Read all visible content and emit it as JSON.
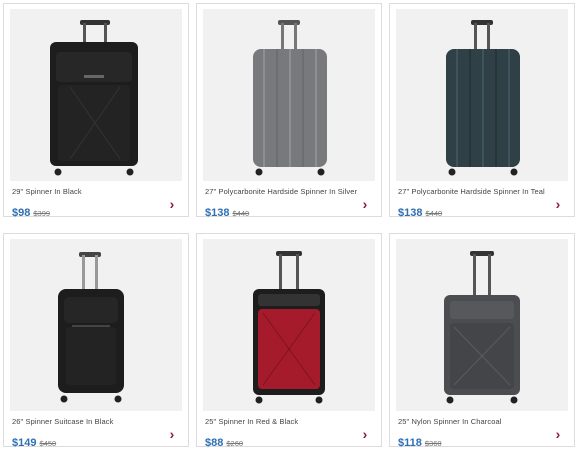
{
  "products": [
    {
      "title": "29\" Spinner In Black",
      "price": "$98",
      "original_price": "$399",
      "icon": "chevron-right-icon",
      "color": "black",
      "kind": "soft"
    },
    {
      "title": "27\" Polycarbonite Hardside Spinner In Silver",
      "price": "$138",
      "original_price": "$440",
      "icon": "chevron-right-icon",
      "color": "silver",
      "kind": "hard"
    },
    {
      "title": "27\" Polycarbonite Hardside Spinner In Teal",
      "price": "$138",
      "original_price": "$440",
      "icon": "chevron-right-icon",
      "color": "teal",
      "kind": "hard"
    },
    {
      "title": "26\" Spinner Suitcase In Black",
      "price": "$149",
      "original_price": "$450",
      "icon": "chevron-right-icon",
      "color": "black",
      "kind": "soft"
    },
    {
      "title": "25\" Spinner In Red & Black",
      "price": "$88",
      "original_price": "$260",
      "icon": "chevron-right-icon",
      "color": "red",
      "kind": "soft"
    },
    {
      "title": "25\" Nylon Spinner In Charcoal",
      "price": "$118",
      "original_price": "$360",
      "icon": "chevron-right-icon",
      "color": "charcoal",
      "kind": "soft"
    }
  ],
  "colors": {
    "price_blue": "#2f6fb3",
    "chevron": "#8b1c3d",
    "photo_bg": "#f1f1f1",
    "black": "#1d1d1d",
    "silver": "#77797c",
    "teal": "#2f4047",
    "red": "#a51b2c",
    "charcoal": "#4b4d50"
  }
}
